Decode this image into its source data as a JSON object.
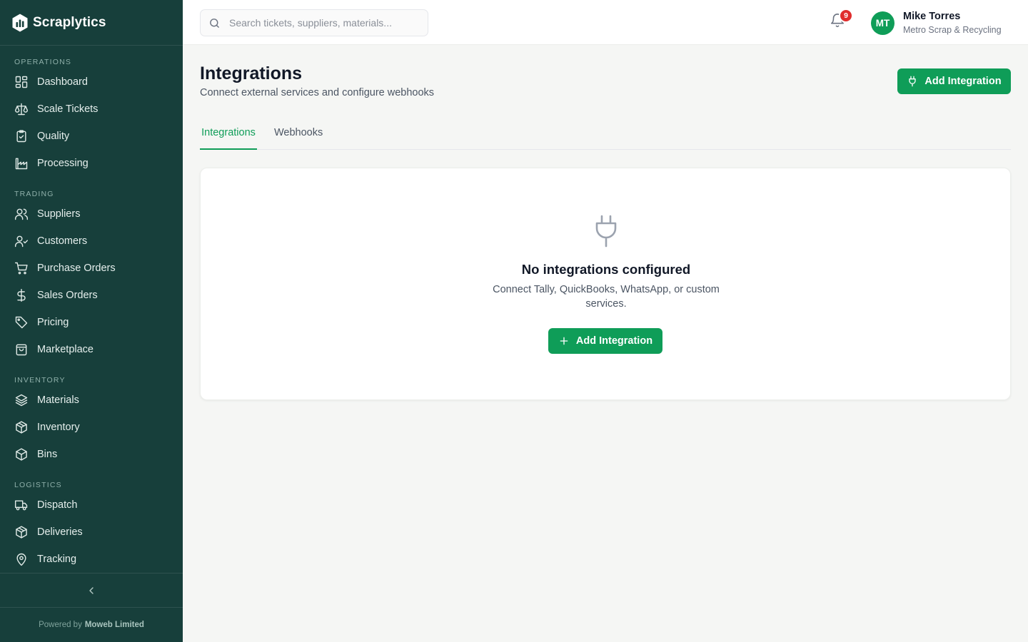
{
  "app": {
    "name": "Scraplytics"
  },
  "sidebar": {
    "sections": [
      {
        "label": "OPERATIONS",
        "items": [
          {
            "label": "Dashboard",
            "icon": "dashboard-icon"
          },
          {
            "label": "Scale Tickets",
            "icon": "scale-icon"
          },
          {
            "label": "Quality",
            "icon": "clipboard-check-icon"
          },
          {
            "label": "Processing",
            "icon": "factory-icon"
          }
        ]
      },
      {
        "label": "TRADING",
        "items": [
          {
            "label": "Suppliers",
            "icon": "users-icon"
          },
          {
            "label": "Customers",
            "icon": "user-check-icon"
          },
          {
            "label": "Purchase Orders",
            "icon": "cart-icon"
          },
          {
            "label": "Sales Orders",
            "icon": "dollar-icon"
          },
          {
            "label": "Pricing",
            "icon": "tag-icon"
          },
          {
            "label": "Marketplace",
            "icon": "shopping-bag-icon"
          }
        ]
      },
      {
        "label": "INVENTORY",
        "items": [
          {
            "label": "Materials",
            "icon": "layers-icon"
          },
          {
            "label": "Inventory",
            "icon": "package-icon"
          },
          {
            "label": "Bins",
            "icon": "box-icon"
          }
        ]
      },
      {
        "label": "LOGISTICS",
        "items": [
          {
            "label": "Dispatch",
            "icon": "truck-icon"
          },
          {
            "label": "Deliveries",
            "icon": "package-check-icon"
          },
          {
            "label": "Tracking",
            "icon": "map-pin-icon"
          }
        ]
      }
    ],
    "powered_by_prefix": "Powered by",
    "powered_by_company": "Moweb Limited"
  },
  "topbar": {
    "search_placeholder": "Search tickets, suppliers, materials...",
    "notifications_count": "9",
    "user": {
      "initials": "MT",
      "name": "Mike Torres",
      "org": "Metro Scrap & Recycling"
    }
  },
  "page": {
    "title": "Integrations",
    "subtitle": "Connect external services and configure webhooks",
    "add_button": "Add Integration",
    "tabs": [
      {
        "label": "Integrations",
        "active": true
      },
      {
        "label": "Webhooks",
        "active": false
      }
    ]
  },
  "empty_state": {
    "title": "No integrations configured",
    "description": "Connect Tally, QuickBooks, WhatsApp, or custom services.",
    "button": "Add Integration"
  },
  "colors": {
    "sidebar_bg": "#173f3b",
    "accent": "#0f9d58",
    "badge": "#e02d2d",
    "page_bg": "#f5f6f4"
  }
}
